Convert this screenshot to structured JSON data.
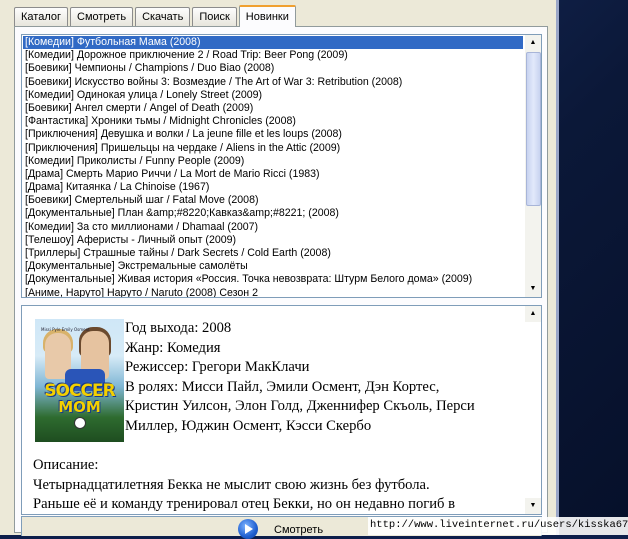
{
  "tabs": [
    {
      "label": "Каталог"
    },
    {
      "label": "Смотреть"
    },
    {
      "label": "Скачать"
    },
    {
      "label": "Поиск"
    },
    {
      "label": "Новинки"
    }
  ],
  "active_tab": "Новинки",
  "movie_list": [
    "[Комедии] Футбольная Мама (2008)",
    "[Комедии] Дорожное приключение 2 / Road Trip: Beer Pong (2009)",
    "[Боевики] Чемпионы / Champions / Duo Biao (2008)",
    "[Боевики] Искусство войны 3: Возмездие / The Art of War 3: Retribution (2008)",
    "[Комедии] Одинокая улица / Lonely Street (2009)",
    "[Боевики] Ангел смерти / Angel of Death (2009)",
    "[Фантастика] Хроники тьмы / Midnight Chronicles (2008)",
    "[Приключения] Девушка и волки / La jeune fille et les loups (2008)",
    "[Приключения] Пришельцы на чердаке / Aliens in the Attic (2009)",
    "[Комедии] Приколисты / Funny People (2009)",
    "[Драма] Смерть Марио Риччи / La Mort de Mario Ricci (1983)",
    "[Драма] Китаянка / La Chinoise (1967)",
    "[Боевики] Смертельный шаг / Fatal Move (2008)",
    "[Документальные] План &amp;#8220;Кавказ&amp;#8221; (2008)",
    "[Комедии] За сто миллионами / Dhamaal (2007)",
    "[Телешоу] Аферисты - Личный опыт (2009)",
    "[Триллеры] Страшные тайны / Dark Secrets / Cold Earth (2008)",
    "[Документальные] Экстремальные самолёты",
    "[Документальные] Живая история «Россия. Точка невозврата: Штурм Белого дома» (2009)",
    "[Аниме, Наруто] Наруто / Naruto (2008) Сезон 2"
  ],
  "selected_index": 0,
  "scrollbar": {
    "up_arrow": "▲",
    "down_arrow": "▼"
  },
  "detail": {
    "poster_title_line1": "SOCCER",
    "poster_title_line2": "MOM",
    "poster_names": "Missi Pyle   Emily Osment",
    "year": "Год выхода: 2008",
    "genre": "Жанр: Комедия",
    "director": "Режиссер: Грегори МакКлачи",
    "cast_lines": [
      "В ролях: Мисси Пайл, Эмили Осмент, Дэн Кортес,",
      "Кристин Уилсон, Элон Голд, Дженнифер Скъоль, Перси",
      "Миллер, Юджин Осмент, Кэсси Скербо"
    ],
    "description_label": "Описание:",
    "description_lines": [
      "Четырнадцатилетняя Бекка не мыслит свою жизнь без футбола.",
      "Раньше её и команду тренировал отец Бекки, но он недавно погиб в"
    ]
  },
  "watch_button": {
    "label": "Смотреть"
  },
  "watermark_url": "http://www.liveinternet.ru/users/kisska67/"
}
